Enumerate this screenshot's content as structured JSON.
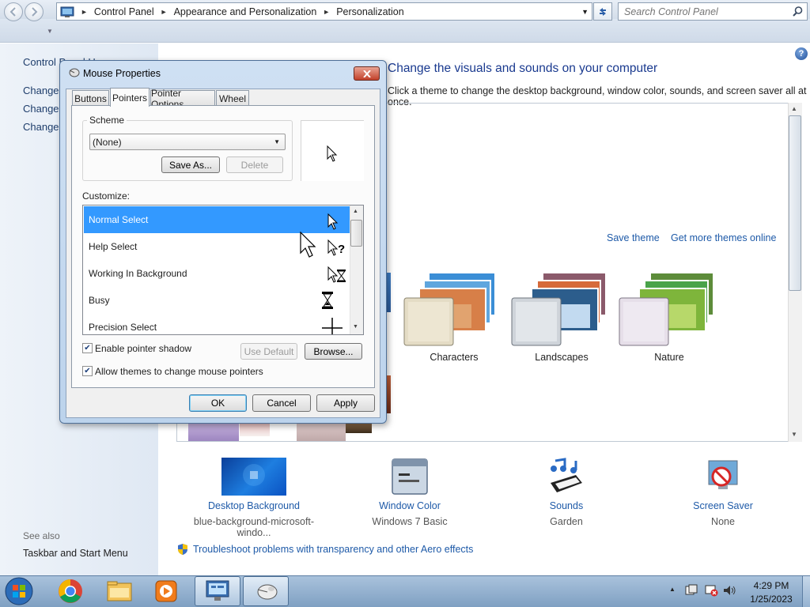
{
  "address": {
    "segments": [
      "Control Panel",
      "Appearance and Personalization",
      "Personalization"
    ]
  },
  "search": {
    "placeholder": "Search Control Panel"
  },
  "left_pane": {
    "links": [
      "Control Panel Home",
      "Change desktop icons",
      "Change mouse pointers",
      "Change your account picture"
    ],
    "see_also": "See also",
    "see_also_links": [
      "Taskbar and Start Menu"
    ]
  },
  "main": {
    "title": "Change the visuals and sounds on your computer",
    "description": "Click a theme to change the desktop background, window color, sounds, and screen saver all at once.",
    "save_theme": "Save theme",
    "get_more_themes": "Get more themes online",
    "themes": [
      {
        "name": "Characters"
      },
      {
        "name": "Landscapes"
      },
      {
        "name": "Nature"
      }
    ],
    "settings": [
      {
        "name": "Desktop Background",
        "value": "blue-background-microsoft-windo...",
        "icon": "desktop-background-icon"
      },
      {
        "name": "Window Color",
        "value": "Windows 7 Basic",
        "icon": "window-color-icon"
      },
      {
        "name": "Sounds",
        "value": "Garden",
        "icon": "sounds-icon"
      },
      {
        "name": "Screen Saver",
        "value": "None",
        "icon": "screen-saver-icon"
      }
    ],
    "troubleshoot": "Troubleshoot problems with transparency and other Aero effects"
  },
  "dialog": {
    "title": "Mouse Properties",
    "tabs": [
      "Buttons",
      "Pointers",
      "Pointer Options",
      "Wheel"
    ],
    "active_tab": "Pointers",
    "scheme_label": "Scheme",
    "scheme_value": "(None)",
    "save_as": "Save As...",
    "delete": "Delete",
    "customize_label": "Customize:",
    "pointers": [
      {
        "name": "Normal Select",
        "icon": "arrow-cursor-icon",
        "selected": true
      },
      {
        "name": "Help Select",
        "icon": "help-cursor-icon",
        "selected": false
      },
      {
        "name": "Working In Background",
        "icon": "working-cursor-icon",
        "selected": false
      },
      {
        "name": "Busy",
        "icon": "hourglass-cursor-icon",
        "selected": false
      },
      {
        "name": "Precision Select",
        "icon": "crosshair-cursor-icon",
        "selected": false
      }
    ],
    "enable_shadow": {
      "label": "Enable pointer shadow",
      "checked": true
    },
    "allow_themes": {
      "label": "Allow themes to change mouse pointers",
      "checked": true
    },
    "use_default": "Use Default",
    "browse": "Browse...",
    "ok": "OK",
    "cancel": "Cancel",
    "apply": "Apply"
  },
  "taskbar": {
    "items": [
      {
        "icon": "chrome-icon",
        "active": false
      },
      {
        "icon": "file-explorer-icon",
        "active": false
      },
      {
        "icon": "media-player-icon",
        "active": false
      },
      {
        "icon": "control-panel-icon",
        "active": true
      },
      {
        "icon": "mouse-icon",
        "active": true
      }
    ],
    "time": "4:29 PM",
    "date": "1/25/2023"
  }
}
